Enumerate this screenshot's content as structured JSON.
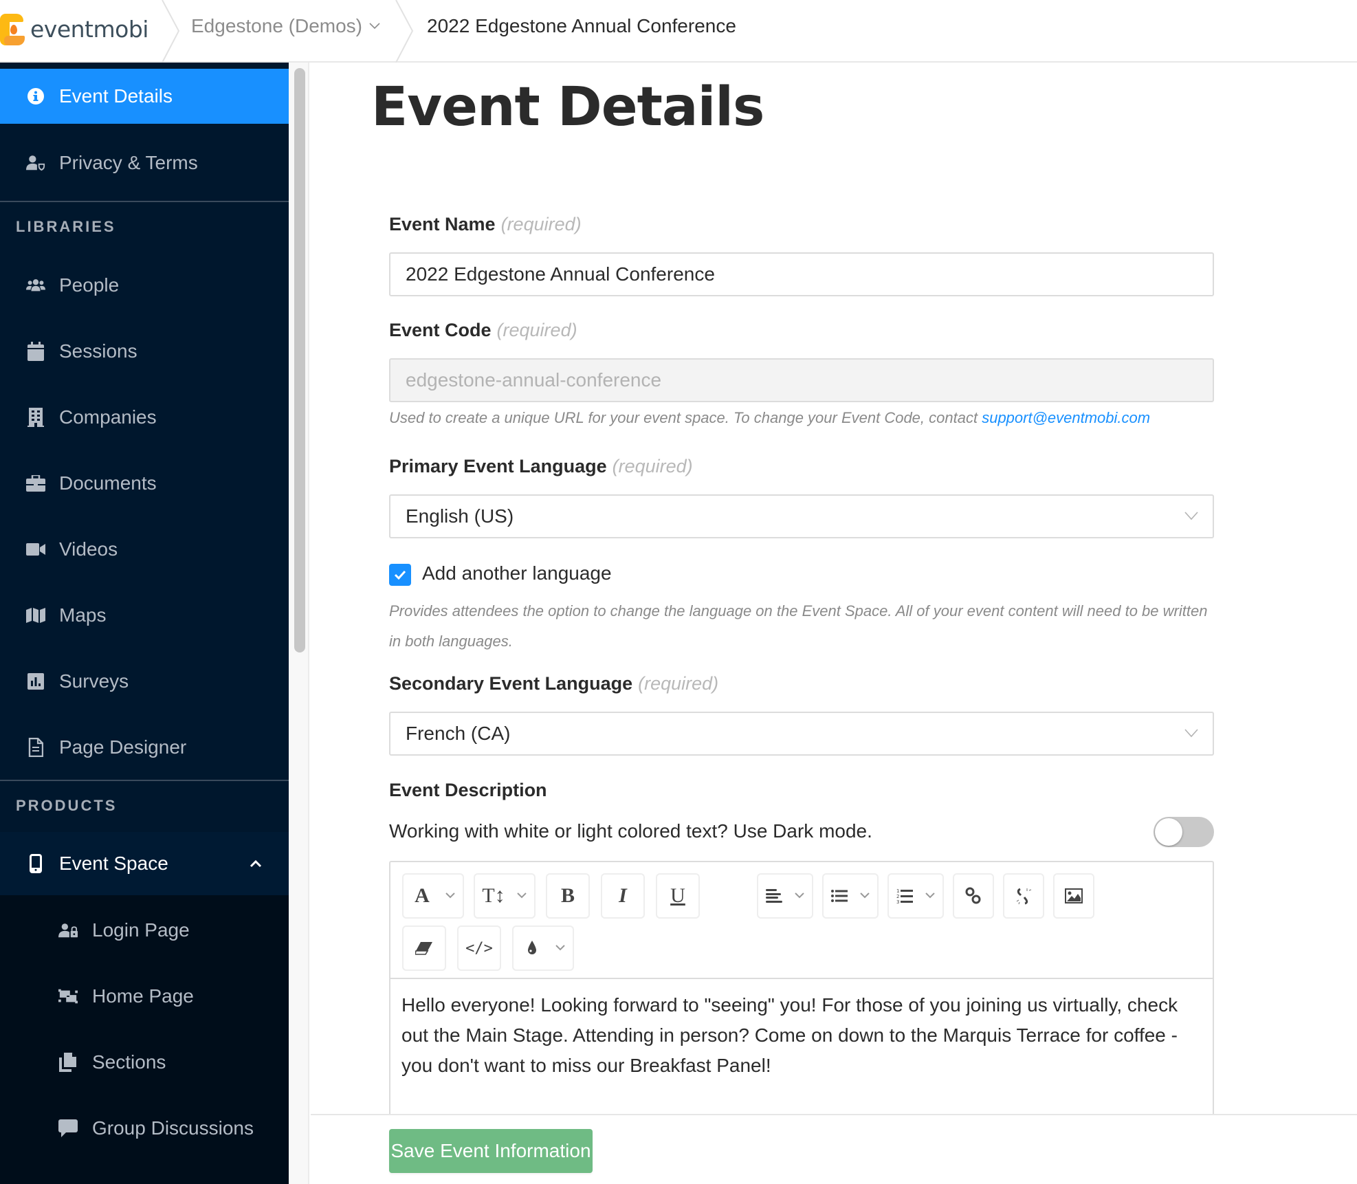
{
  "header": {
    "logo_text": "eventmobi",
    "organization": "Edgestone (Demos)",
    "event_title": "2022 Edgestone Annual Conference"
  },
  "sidebar": {
    "top_items": [
      {
        "label": "Event Details",
        "icon": "info-circle-icon",
        "active": true
      },
      {
        "label": "Privacy & Terms",
        "icon": "user-shield-icon",
        "active": false
      }
    ],
    "libraries_heading": "LIBRARIES",
    "libraries": [
      {
        "label": "People",
        "icon": "users-icon"
      },
      {
        "label": "Sessions",
        "icon": "calendar-icon"
      },
      {
        "label": "Companies",
        "icon": "building-icon"
      },
      {
        "label": "Documents",
        "icon": "briefcase-icon"
      },
      {
        "label": "Videos",
        "icon": "video-camera-icon"
      },
      {
        "label": "Maps",
        "icon": "map-icon"
      },
      {
        "label": "Surveys",
        "icon": "bar-chart-icon"
      },
      {
        "label": "Page Designer",
        "icon": "file-icon"
      }
    ],
    "products_heading": "PRODUCTS",
    "products": [
      {
        "label": "Event Space",
        "icon": "mobile-icon",
        "expanded": true
      }
    ],
    "event_space_sub": [
      {
        "label": "Login Page",
        "icon": "user-lock-icon"
      },
      {
        "label": "Home Page",
        "icon": "object-group-icon"
      },
      {
        "label": "Sections",
        "icon": "copy-icon"
      },
      {
        "label": "Group Discussions",
        "icon": "comment-icon"
      }
    ]
  },
  "main": {
    "title": "Event Details",
    "required_tag": "(required)",
    "event_name": {
      "label": "Event Name",
      "value": "2022 Edgestone Annual Conference"
    },
    "event_code": {
      "label": "Event Code",
      "value": "edgestone-annual-conference",
      "help_prefix": "Used to create a unique URL for your event space. To change your Event Code, contact ",
      "help_link": "support@eventmobi.com"
    },
    "primary_language": {
      "label": "Primary Event Language",
      "value": "English (US)"
    },
    "add_language": {
      "label": "Add another language",
      "checked": true,
      "help": "Provides attendees the option to change the language on the Event Space. All of your event content will need to be written in both languages."
    },
    "secondary_language": {
      "label": "Secondary Event Language",
      "value": "French (CA)"
    },
    "description": {
      "label": "Event Description",
      "dark_mode_text": "Working with white or light colored text? Use Dark mode.",
      "dark_mode_on": false,
      "toolbar": {
        "font_color_glyph": "A",
        "text_size_glyph": "T↕",
        "bold_glyph": "B",
        "italic_glyph": "I",
        "underline_glyph": "U",
        "code_glyph": "</>"
      },
      "body": "Hello everyone! Looking forward to \"seeing\" you! For those of you joining us virtually, check out the Main Stage. Attending in person? Come on down to the Marquis Terrace for coffee - you don't want to miss our Breakfast Panel!"
    },
    "save_button": "Save Event Information"
  },
  "colors": {
    "sidebar_bg": "#00172d",
    "active_item": "#1890ff",
    "save_button": "#6fbb84",
    "link": "#1890ff"
  }
}
